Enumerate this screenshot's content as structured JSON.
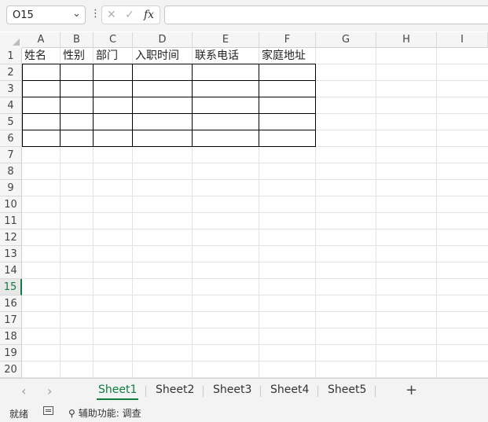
{
  "formula_bar": {
    "name_box": "O15",
    "cancel_glyph": "✕",
    "enter_glyph": "✓",
    "fx_label": "fx",
    "formula_value": ""
  },
  "columns": [
    "A",
    "B",
    "C",
    "D",
    "E",
    "F",
    "G",
    "H",
    "I"
  ],
  "rows": [
    "1",
    "2",
    "3",
    "4",
    "5",
    "6",
    "7",
    "8",
    "9",
    "10",
    "11",
    "12",
    "13",
    "14",
    "15",
    "16",
    "17",
    "18",
    "19",
    "20"
  ],
  "selected_row": "15",
  "headers": [
    "姓名",
    "性别",
    "部门",
    "入职时间",
    "联系电话",
    "家庭地址"
  ],
  "sheets": [
    "Sheet1",
    "Sheet2",
    "Sheet3",
    "Sheet4",
    "Sheet5"
  ],
  "active_sheet": "Sheet1",
  "tab_nav": {
    "prev": "‹",
    "next": "›",
    "add": "+"
  },
  "status": {
    "ready": "就绪",
    "accessibility": "辅助功能: 调查"
  },
  "colors": {
    "accent": "#107c41",
    "grid": "#e3e3e3",
    "header_bg": "#f5f5f5"
  }
}
